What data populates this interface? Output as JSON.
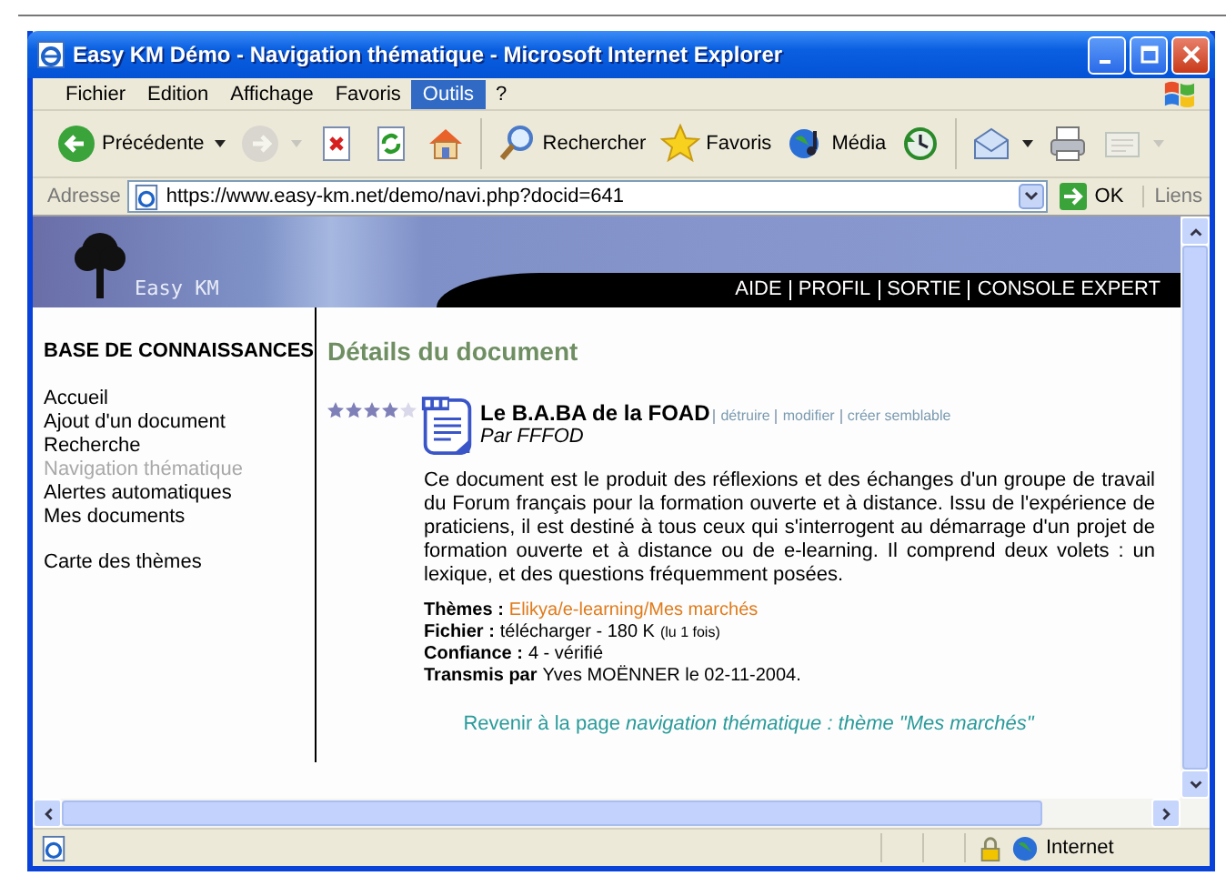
{
  "window": {
    "title": "Easy KM Démo - Navigation thématique - Microsoft Internet Explorer"
  },
  "menu": [
    {
      "label": "Fichier",
      "selected": false
    },
    {
      "label": "Edition",
      "selected": false
    },
    {
      "label": "Affichage",
      "selected": false
    },
    {
      "label": "Favoris",
      "selected": false
    },
    {
      "label": "Outils",
      "selected": true
    },
    {
      "label": "?",
      "selected": false
    }
  ],
  "toolbar": [
    {
      "kind": "back",
      "label": "Précédente",
      "disabled": false
    },
    {
      "kind": "forward",
      "disabled": true
    },
    {
      "kind": "stop",
      "disabled": false
    },
    {
      "kind": "refresh",
      "disabled": false
    },
    {
      "kind": "home",
      "disabled": false
    },
    {
      "kind": "search",
      "label": "Rechercher",
      "disabled": false
    },
    {
      "kind": "favorites",
      "label": "Favoris",
      "disabled": false
    },
    {
      "kind": "media",
      "label": "Média",
      "disabled": false
    },
    {
      "kind": "history",
      "disabled": false
    },
    {
      "kind": "mail",
      "disabled": false
    },
    {
      "kind": "print",
      "disabled": false
    },
    {
      "kind": "edit",
      "disabled": true
    }
  ],
  "address": {
    "label": "Adresse",
    "value": "https://www.easy-km.net/demo/navi.php?docid=641",
    "go": "OK",
    "links": "Liens"
  },
  "site": {
    "logo": "Easy KM",
    "top_links": [
      "AIDE",
      "PROFIL",
      "SORTIE",
      "CONSOLE EXPERT"
    ]
  },
  "sidebar": {
    "heading": "BASE DE CONNAISSANCES",
    "sections": [
      {
        "items": [
          {
            "label": "Accueil",
            "selected": false
          },
          {
            "label": "Ajout d'un document",
            "selected": false
          },
          {
            "label": "Recherche",
            "selected": false
          },
          {
            "label": "Navigation thématique",
            "selected": true
          },
          {
            "label": "Alertes automatiques",
            "selected": false
          },
          {
            "label": "Mes documents",
            "selected": false
          }
        ]
      },
      {
        "items": [
          {
            "label": "Carte des thèmes",
            "selected": false
          }
        ]
      }
    ]
  },
  "document": {
    "heading": "Détails du document",
    "stars": 4,
    "title": "Le B.A.BA de la FOAD",
    "actions": [
      "détruire",
      "modifier",
      "créer semblable"
    ],
    "author": "Par FFFOD",
    "description": "Ce document est le produit des réflexions et des échanges d'un groupe de travail du Forum français pour la formation ouverte et à distance. Issu de l'expérience de praticiens, il est destiné à tous ceux qui s'interrogent au démarrage d'un projet de formation ouverte et à distance ou de e-learning. Il comprend deux volets : un lexique, et des questions fréquemment posées.",
    "fields": [
      {
        "label": "Thèmes :",
        "kind": "link",
        "value": "Elikya/e-learning/Mes marchés"
      },
      {
        "label": "Fichier :",
        "kind": "text",
        "value": "télécharger - 180 K",
        "note": "(lu 1 fois)"
      },
      {
        "label": "Confiance :",
        "kind": "text",
        "value": "4 - vérifié"
      },
      {
        "label": "Transmis par",
        "kind": "text",
        "value": "Yves MOËNNER le 02-11-2004."
      }
    ],
    "back_link": "Revenir à la page *navigation thématique : thème \"Mes marchés\"*"
  },
  "status_bar": {
    "zone": "Internet"
  }
}
